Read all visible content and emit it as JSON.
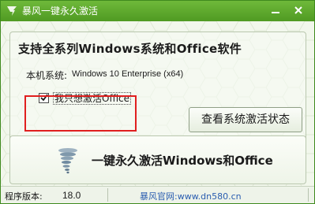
{
  "window": {
    "title": "暴风一键永久激活",
    "minimize_icon": "minimize-icon",
    "close_icon": "close-icon",
    "accent_color": "#4f9a22"
  },
  "group": {
    "title": "支持全系列Windows系统和Office软件",
    "system_label": "本机系统:",
    "system_value": "Windows 10 Enterprise (x64)",
    "office_checkbox_label": "我只想激活Office",
    "office_checkbox_checked": true,
    "status_button_label": "查看系统激活状态",
    "highlight_color": "#e01f1f"
  },
  "activate": {
    "label": "一键永久激活Windows和Office",
    "icon": "tornado-icon"
  },
  "statusbar": {
    "version_label": "程序版本:",
    "version_value": "18.0",
    "site_text": "暴风官网:www.dn580.cn",
    "link_color": "#2a5db0"
  }
}
